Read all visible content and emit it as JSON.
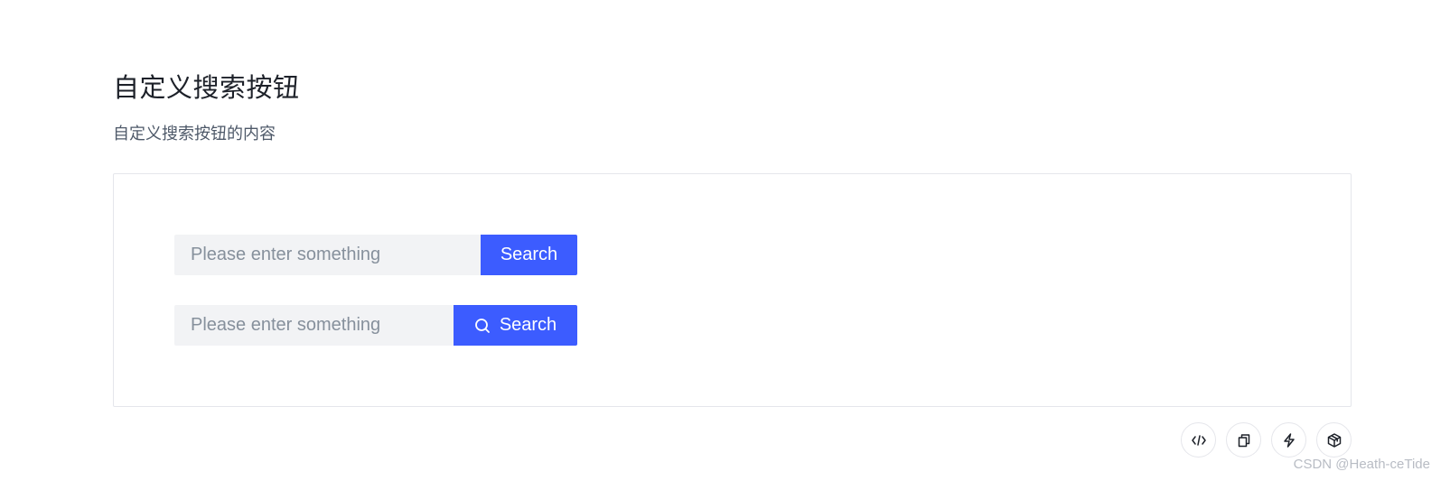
{
  "page": {
    "title": "自定义搜索按钮",
    "description": "自定义搜索按钮的内容"
  },
  "demo": {
    "search_rows": [
      {
        "placeholder": "Please enter something",
        "button_label": "Search",
        "button_icon": ""
      },
      {
        "placeholder": "Please enter something",
        "button_label": "Search",
        "button_icon": "search-icon"
      }
    ]
  },
  "toolbar": {
    "icons": [
      "code-icon",
      "copy-icon",
      "lightning-icon",
      "codesandbox-icon"
    ]
  },
  "watermark": "CSDN @Heath-ceTide",
  "colors": {
    "primary": "#3c5cff",
    "input_bg": "#f2f3f5",
    "border": "#e5e6eb",
    "text": "#1d2129",
    "secondary_text": "#4e5969",
    "placeholder": "#86909c"
  }
}
